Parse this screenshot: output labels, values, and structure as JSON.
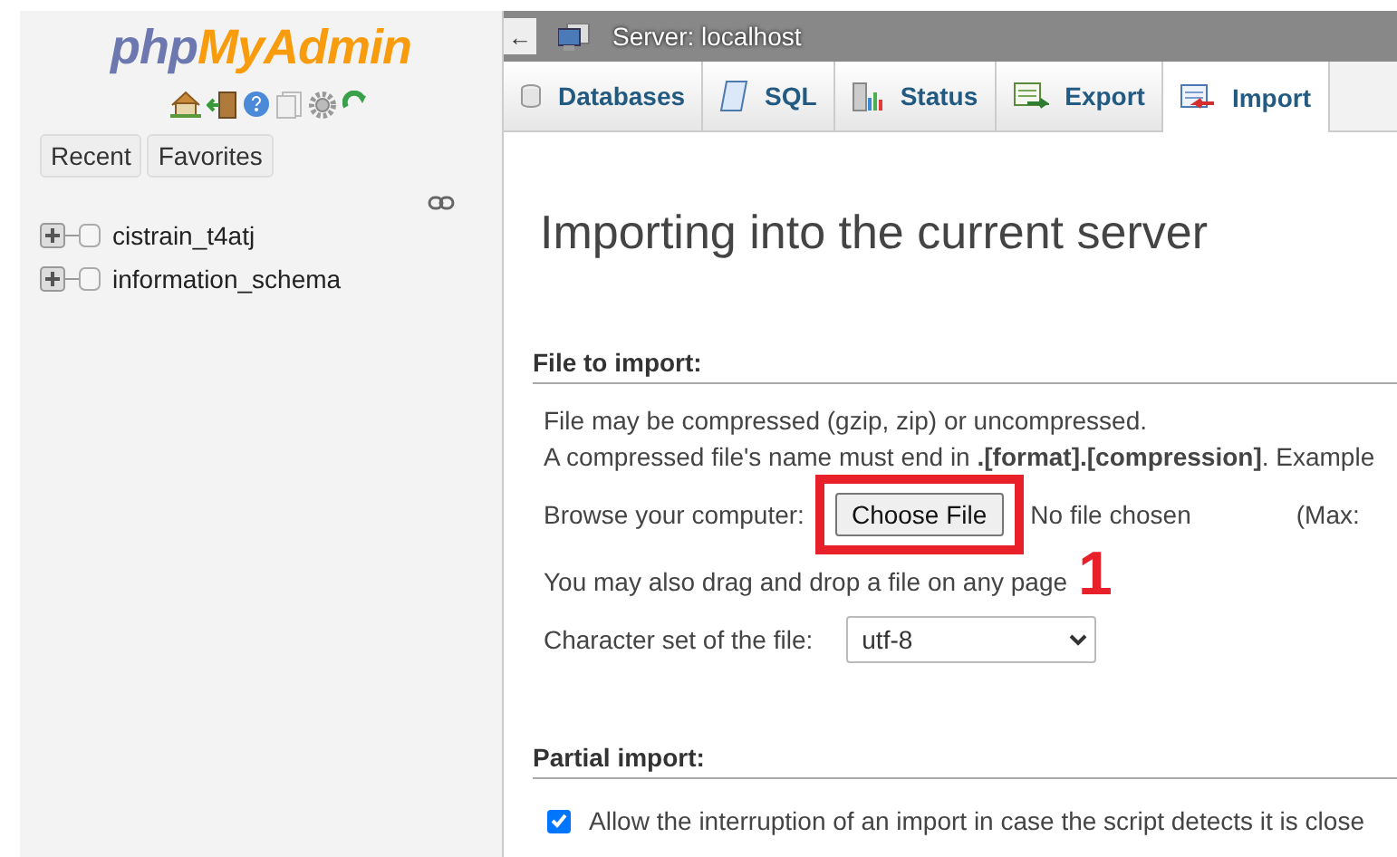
{
  "sidebar": {
    "logo": {
      "part_1": "php",
      "part_2": "MyAdmin"
    },
    "buttons": [
      "Recent",
      "Favorites"
    ],
    "tree": [
      {
        "label": "cistrain_t4atj",
        "expanded": false
      },
      {
        "label": "information_schema",
        "expanded": false
      }
    ]
  },
  "server_bar": {
    "back": "←",
    "title": "Server: localhost"
  },
  "tabs": [
    {
      "label": "Databases",
      "selected": false
    },
    {
      "label": "SQL",
      "selected": false
    },
    {
      "label": "Status",
      "selected": false
    },
    {
      "label": "Export",
      "selected": false
    },
    {
      "label": "Import",
      "selected": true
    }
  ],
  "heading": "Importing into the current server",
  "file_section": {
    "title": "File to import:",
    "note_1": "File may be compressed (gzip, zip) or uncompressed.",
    "note_2": "A compressed file's name must end in **.[format].[compression]**. Example",
    "browse_label": "Browse your computer:",
    "choose_button": "Choose File",
    "no_file": "No file chosen",
    "max": "(Max:",
    "drag_note": "You may also drag and drop a file on any page",
    "charset_label": "Character set of the file:",
    "charset_value": "utf-8"
  },
  "annotation": {
    "number": "1"
  },
  "partial_section": {
    "title": "Partial import:",
    "option": {
      "label": "Allow the interruption of an import in case the script detects it is close",
      "checked": true
    }
  }
}
